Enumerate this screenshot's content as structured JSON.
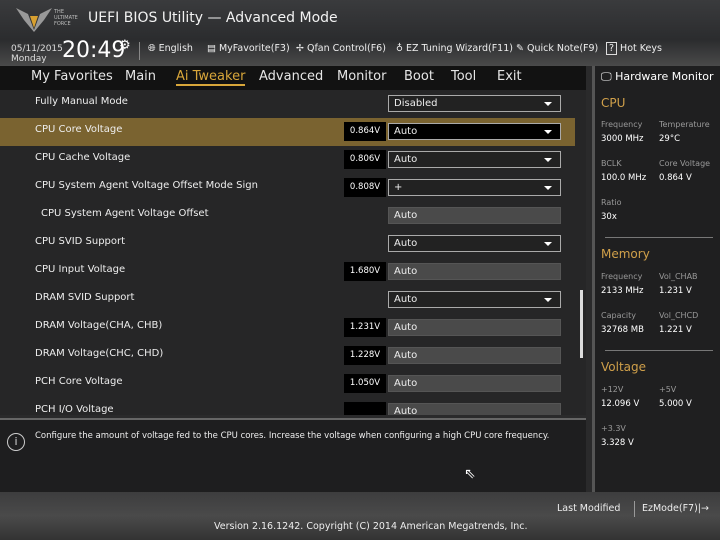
{
  "header": {
    "logo_text": "THE ULTIMATE FORCE",
    "title": "UEFI BIOS Utility — Advanced Mode",
    "date": "05/11/2015",
    "day": "Monday",
    "time": "20:49",
    "toolbar": [
      {
        "icon": "globe-icon",
        "label": "English"
      },
      {
        "icon": "favorite-icon",
        "label": "MyFavorite(F3)"
      },
      {
        "icon": "fan-icon",
        "label": "Qfan Control(F6)"
      },
      {
        "icon": "lightbulb-icon",
        "label": "EZ Tuning Wizard(F11)"
      },
      {
        "icon": "note-icon",
        "label": "Quick Note(F9)"
      },
      {
        "icon": "help-icon",
        "label": "Hot Keys"
      }
    ]
  },
  "nav": {
    "tabs": [
      "My Favorites",
      "Main",
      "Ai Tweaker",
      "Advanced",
      "Monitor",
      "Boot",
      "Tool",
      "Exit"
    ],
    "active": "Ai Tweaker"
  },
  "settings": [
    {
      "name": "Fully Manual Mode",
      "value": "",
      "control": "Disabled",
      "type": "dropdown"
    },
    {
      "name": "CPU Core Voltage",
      "value": "0.864V",
      "control": "Auto",
      "type": "dropdown",
      "selected": true
    },
    {
      "name": "CPU Cache Voltage",
      "value": "0.806V",
      "control": "Auto",
      "type": "dropdown"
    },
    {
      "name": "CPU System Agent Voltage Offset Mode Sign",
      "value": "0.808V",
      "control": "+",
      "type": "dropdown"
    },
    {
      "name": "CPU System Agent Voltage Offset",
      "value": "",
      "control": "Auto",
      "type": "readonly",
      "indent": true
    },
    {
      "name": "CPU SVID Support",
      "value": "",
      "control": "Auto",
      "type": "dropdown"
    },
    {
      "name": "CPU Input Voltage",
      "value": "1.680V",
      "control": "Auto",
      "type": "readonly"
    },
    {
      "name": "DRAM SVID Support",
      "value": "",
      "control": "Auto",
      "type": "dropdown"
    },
    {
      "name": "DRAM Voltage(CHA, CHB)",
      "value": "1.231V",
      "control": "Auto",
      "type": "readonly"
    },
    {
      "name": "DRAM Voltage(CHC, CHD)",
      "value": "1.228V",
      "control": "Auto",
      "type": "readonly"
    },
    {
      "name": "PCH Core Voltage",
      "value": "1.050V",
      "control": "Auto",
      "type": "readonly"
    },
    {
      "name": "PCH I/O Voltage",
      "value": "",
      "control": "Auto",
      "type": "readonly"
    }
  ],
  "info": "Configure the amount of voltage fed to the CPU cores. Increase the voltage when configuring a high CPU core frequency.",
  "hardware_monitor": {
    "title": "Hardware Monitor",
    "cpu": {
      "title": "CPU",
      "frequency_label": "Frequency",
      "frequency": "3000 MHz",
      "temperature_label": "Temperature",
      "temperature": "29°C",
      "bclk_label": "BCLK",
      "bclk": "100.0 MHz",
      "core_voltage_label": "Core Voltage",
      "core_voltage": "0.864 V",
      "ratio_label": "Ratio",
      "ratio": "30x"
    },
    "memory": {
      "title": "Memory",
      "frequency_label": "Frequency",
      "frequency": "2133 MHz",
      "vol_chab_label": "Vol_CHAB",
      "vol_chab": "1.231 V",
      "capacity_label": "Capacity",
      "capacity": "32768 MB",
      "vol_chcd_label": "Vol_CHCD",
      "vol_chcd": "1.221 V"
    },
    "voltage": {
      "title": "Voltage",
      "v12_label": "+12V",
      "v12": "12.096 V",
      "v5_label": "+5V",
      "v5": "5.000 V",
      "v33_label": "+3.3V",
      "v33": "3.328 V"
    }
  },
  "footer": {
    "last_modified": "Last Modified",
    "ezmode": "EzMode(F7)|→",
    "version": "Version 2.16.1242. Copyright (C) 2014 American Megatrends, Inc."
  }
}
